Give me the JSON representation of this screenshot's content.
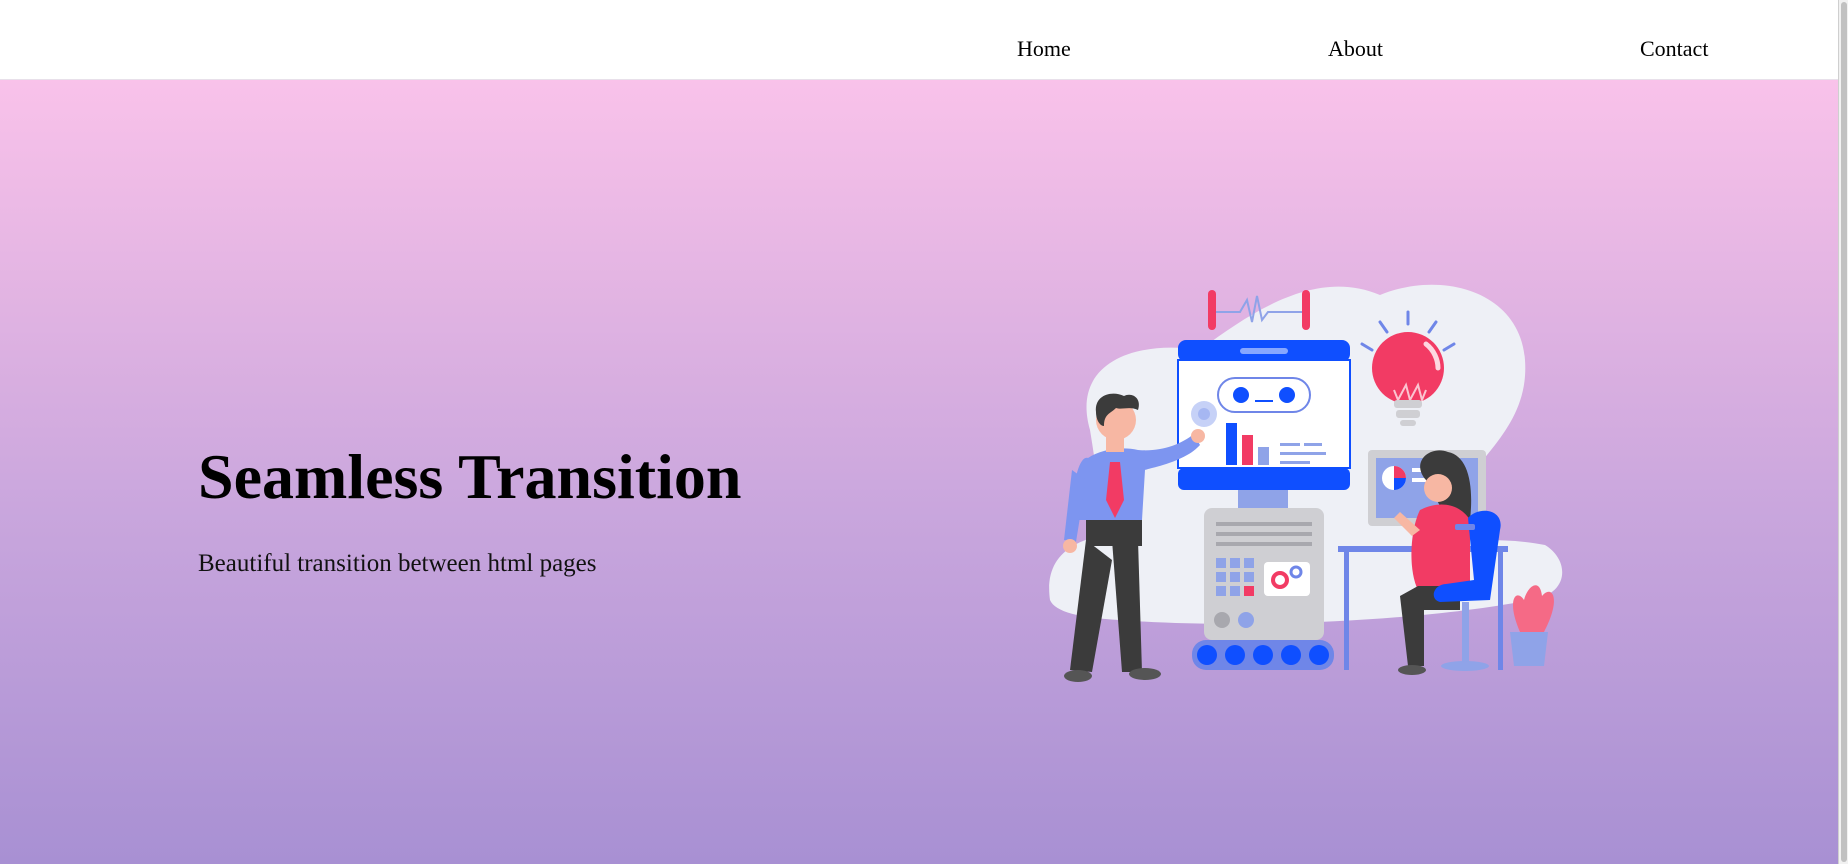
{
  "nav": {
    "home": "Home",
    "about": "About",
    "contact": "Contact"
  },
  "hero": {
    "title": "Seamless Transition",
    "subtitle": "Beautiful transition between html pages"
  },
  "colors": {
    "gradient_top": "#f9c2ea",
    "gradient_bottom": "#a890d3",
    "accent_blue": "#0f4fff",
    "accent_red": "#f23b64"
  },
  "illustration": {
    "icon": "people-robot-dashboard-illustration"
  }
}
